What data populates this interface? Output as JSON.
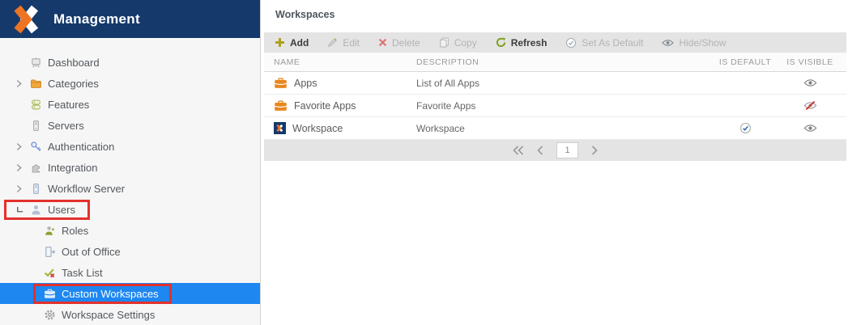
{
  "app": {
    "title": "Management"
  },
  "colors": {
    "header_navy": "#15396b",
    "selection_blue": "#1e87f0",
    "annotation_red": "#e3302c",
    "brand_orange": "#ee7423",
    "toolbar_gray": "#e4e4e4",
    "enabled_green": "#7fa01f"
  },
  "sidebar": {
    "items": [
      {
        "label": "Dashboard",
        "icon": "dashboard-icon",
        "expand": "none"
      },
      {
        "label": "Categories",
        "icon": "folder-icon",
        "expand": "collapsed"
      },
      {
        "label": "Features",
        "icon": "features-icon",
        "expand": "none"
      },
      {
        "label": "Servers",
        "icon": "server-icon",
        "expand": "none"
      },
      {
        "label": "Authentication",
        "icon": "key-icon",
        "expand": "collapsed"
      },
      {
        "label": "Integration",
        "icon": "puzzle-icon",
        "expand": "collapsed"
      },
      {
        "label": "Workflow Server",
        "icon": "server-icon",
        "expand": "collapsed"
      },
      {
        "label": "Users",
        "icon": "user-icon",
        "expand": "expanded",
        "highlighted": true
      },
      {
        "label": "Roles",
        "icon": "roles-icon",
        "child": true
      },
      {
        "label": "Out of Office",
        "icon": "door-exit-icon",
        "child": true
      },
      {
        "label": "Task List",
        "icon": "task-check-icon",
        "child": true
      },
      {
        "label": "Custom Workspaces",
        "icon": "briefcase-icon",
        "child": true,
        "selected": true,
        "highlighted": true
      },
      {
        "label": "Workspace Settings",
        "icon": "gear-icon",
        "child": true
      }
    ]
  },
  "main": {
    "title": "Workspaces",
    "toolbar": [
      {
        "label": "Add",
        "icon": "plus-icon",
        "enabled": true
      },
      {
        "label": "Edit",
        "icon": "pencil-icon",
        "enabled": false
      },
      {
        "label": "Delete",
        "icon": "x-icon",
        "enabled": false
      },
      {
        "label": "Copy",
        "icon": "copy-icon",
        "enabled": false
      },
      {
        "label": "Refresh",
        "icon": "refresh-icon",
        "enabled": true
      },
      {
        "label": "Set As Default",
        "icon": "circle-check-icon",
        "enabled": false
      },
      {
        "label": "Hide/Show",
        "icon": "eye-icon",
        "enabled": false
      }
    ],
    "table": {
      "columns": [
        "NAME",
        "DESCRIPTION",
        "IS DEFAULT",
        "IS VISIBLE"
      ],
      "rows": [
        {
          "name": "Apps",
          "icon": "briefcase-icon",
          "description": "List of All Apps",
          "is_default": false,
          "is_visible": true
        },
        {
          "name": "Favorite Apps",
          "icon": "briefcase-icon",
          "description": "Favorite Apps",
          "is_default": false,
          "is_visible": false
        },
        {
          "name": "Workspace",
          "icon": "logo-tile-icon",
          "description": "Workspace",
          "is_default": true,
          "is_visible": true
        }
      ]
    },
    "pagination": {
      "page": "1"
    }
  }
}
